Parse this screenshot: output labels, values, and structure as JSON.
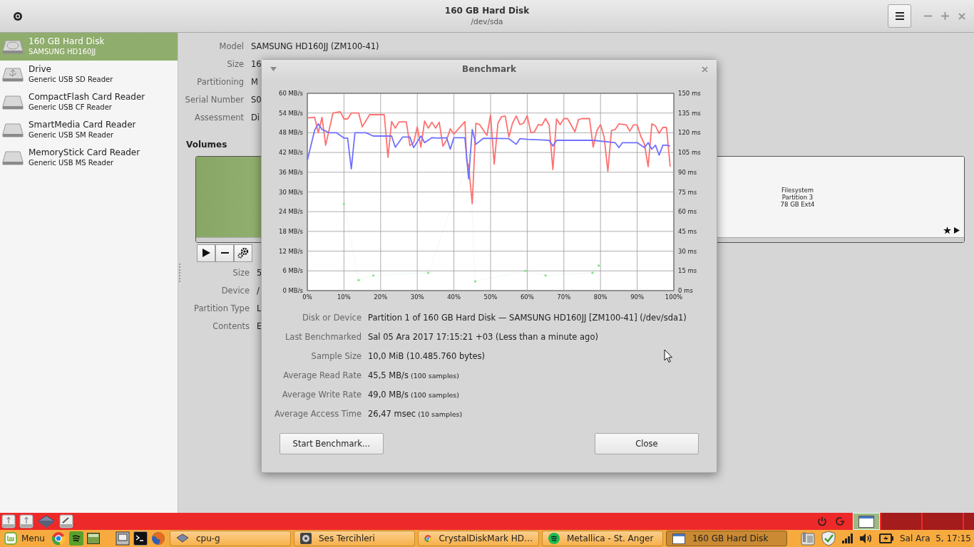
{
  "window": {
    "title": "160 GB Hard Disk",
    "subtitle": "/dev/sda"
  },
  "sidebar": {
    "items": [
      {
        "name": "160 GB Hard Disk",
        "detail": "SAMSUNG HD160JJ",
        "kind": "hdd",
        "selected": true
      },
      {
        "name": "Drive",
        "detail": "Generic USB SD Reader",
        "kind": "usb",
        "selected": false
      },
      {
        "name": "CompactFlash Card Reader",
        "detail": "Generic USB CF Reader",
        "kind": "card",
        "selected": false
      },
      {
        "name": "SmartMedia Card Reader",
        "detail": "Generic USB SM Reader",
        "kind": "card",
        "selected": false
      },
      {
        "name": "MemoryStick Card Reader",
        "detail": "Generic USB MS Reader",
        "kind": "card",
        "selected": false
      }
    ]
  },
  "drive_details": [
    {
      "label": "Model",
      "value": "SAMSUNG HD160JJ (ZM100-41)"
    },
    {
      "label": "Size",
      "value": "16"
    },
    {
      "label": "Partitioning",
      "value": "M"
    },
    {
      "label": "Serial Number",
      "value": "S0"
    },
    {
      "label": "Assessment",
      "value": "Di"
    }
  ],
  "volumes": {
    "heading": "Volumes",
    "partition_lines": [
      "Filesystem",
      "Partition 3",
      "78 GB Ext4"
    ]
  },
  "volume_details": [
    {
      "label": "Size",
      "value": "5"
    },
    {
      "label": "Device",
      "value": "/"
    },
    {
      "label": "Partition Type",
      "value": "L"
    },
    {
      "label": "Contents",
      "value": "E"
    }
  ],
  "dialog": {
    "title": "Benchmark",
    "chart_data": {
      "type": "line",
      "grid": true,
      "xlim": [
        0,
        100
      ],
      "ylim": [
        0,
        60
      ],
      "y2lim": [
        0,
        150
      ],
      "xticks": [
        {
          "value": 0,
          "label": "0%"
        },
        {
          "value": 10,
          "label": "10%"
        },
        {
          "value": 20,
          "label": "20%"
        },
        {
          "value": 30,
          "label": "30%"
        },
        {
          "value": 40,
          "label": "40%"
        },
        {
          "value": 50,
          "label": "50%"
        },
        {
          "value": 60,
          "label": "60%"
        },
        {
          "value": 70,
          "label": "70%"
        },
        {
          "value": 80,
          "label": "80%"
        },
        {
          "value": 90,
          "label": "90%"
        },
        {
          "value": 100,
          "label": "100%"
        }
      ],
      "yticks": [
        {
          "value": 0,
          "label": "0 MB/s"
        },
        {
          "value": 6,
          "label": "6 MB/s"
        },
        {
          "value": 12,
          "label": "12 MB/s"
        },
        {
          "value": 18,
          "label": "18 MB/s"
        },
        {
          "value": 24,
          "label": "24 MB/s"
        },
        {
          "value": 30,
          "label": "30 MB/s"
        },
        {
          "value": 36,
          "label": "36 MB/s"
        },
        {
          "value": 42,
          "label": "42 MB/s"
        },
        {
          "value": 48,
          "label": "48 MB/s"
        },
        {
          "value": 54,
          "label": "54 MB/s"
        },
        {
          "value": 60,
          "label": "60 MB/s"
        }
      ],
      "y2ticks": [
        {
          "value": 0,
          "label": "0 ms"
        },
        {
          "value": 15,
          "label": "15 ms"
        },
        {
          "value": 30,
          "label": "30 ms"
        },
        {
          "value": 45,
          "label": "45 ms"
        },
        {
          "value": 60,
          "label": "60 ms"
        },
        {
          "value": 75,
          "label": "75 ms"
        },
        {
          "value": 90,
          "label": "90 ms"
        },
        {
          "value": 105,
          "label": "105 ms"
        },
        {
          "value": 120,
          "label": "120 ms"
        },
        {
          "value": 135,
          "label": "135 ms"
        },
        {
          "value": 150,
          "label": "150 ms"
        }
      ],
      "series": [
        {
          "color": "#ff7070",
          "x": [
            0,
            2,
            3,
            4,
            5,
            7,
            9,
            10,
            11,
            12,
            14,
            15,
            17,
            21,
            22,
            23,
            24,
            25,
            27,
            28,
            29,
            30,
            31,
            32,
            33,
            34,
            35,
            36,
            37,
            38,
            39,
            40,
            43,
            43.5,
            44,
            45,
            46,
            47,
            49,
            50,
            51,
            52,
            53,
            54,
            55,
            56,
            57,
            58,
            59,
            60,
            61,
            62,
            63,
            64,
            65,
            66,
            67,
            68,
            69,
            70,
            71,
            72,
            73,
            74,
            75,
            77,
            78,
            79,
            80,
            81,
            82,
            83,
            84,
            85,
            87,
            88,
            89,
            90,
            91,
            92,
            93,
            94,
            95,
            96,
            97,
            98,
            99
          ],
          "values": [
            52.5,
            52.7,
            48,
            52.7,
            44.2,
            54,
            54.4,
            52.2,
            52.2,
            54,
            54,
            49.8,
            53.5,
            53.5,
            40.5,
            51.4,
            49.4,
            51.3,
            51.3,
            44.1,
            45,
            49.8,
            43.6,
            51.6,
            49.4,
            51.2,
            49.4,
            51.2,
            43.9,
            45.8,
            49.2,
            47.6,
            51.4,
            39.4,
            38,
            26.4,
            50.9,
            50.5,
            47.2,
            53.4,
            38.5,
            50.9,
            52.9,
            53.1,
            46.7,
            50.9,
            53.1,
            50.5,
            50.9,
            53.2,
            48,
            48.3,
            50.5,
            50.3,
            52.3,
            50.3,
            36.8,
            52.2,
            50.5,
            52.3,
            52.3,
            50.3,
            48.3,
            52,
            52.3,
            52.3,
            43.6,
            48.7,
            50.5,
            46.7,
            36.3,
            48.7,
            49,
            50.7,
            50.4,
            48.5,
            50.4,
            50.4,
            46.9,
            44.5,
            37.7,
            50.7,
            50.1,
            47.8,
            49.6,
            49.6,
            37.7
          ]
        },
        {
          "color": "#7070ff",
          "x": [
            0,
            2,
            3,
            4,
            6,
            8,
            10,
            11,
            12,
            13,
            16,
            18,
            23,
            24,
            26,
            28,
            29,
            31,
            32,
            34,
            36,
            38,
            39,
            40,
            43,
            44,
            45,
            46,
            48,
            55,
            57,
            58,
            60,
            66,
            67,
            68,
            78,
            84,
            85,
            86,
            90,
            92,
            93,
            94,
            95,
            96,
            97,
            98,
            99
          ],
          "values": [
            39.6,
            48.8,
            50.7,
            49,
            48,
            48,
            46.4,
            46.4,
            37,
            48,
            48,
            47,
            47,
            43.6,
            46.7,
            46.7,
            43.5,
            47,
            45,
            46.5,
            46.4,
            46.5,
            43,
            46.5,
            46.5,
            34,
            49,
            44.5,
            46.3,
            46.2,
            44.5,
            46.2,
            46,
            45.7,
            44,
            45.7,
            45.7,
            45,
            43.5,
            45,
            45,
            43.5,
            45,
            43,
            44.2,
            41.2,
            44.2,
            44.2,
            44
          ]
        },
        {
          "axis": "y2",
          "color": "#7ee07e",
          "x": [
            10,
            14,
            18,
            33,
            44.3,
            45.8,
            59.5,
            65,
            77.8,
            79.5
          ],
          "values": [
            66,
            8,
            11.5,
            13.5,
            103,
            7,
            15,
            11.5,
            13.5,
            19
          ]
        }
      ]
    },
    "rows": [
      {
        "label": "Disk or Device",
        "value": "Partition 1 of 160 GB Hard Disk — SAMSUNG HD160JJ [ZM100-41] (/dev/sda1)"
      },
      {
        "label": "Last Benchmarked",
        "value": "Sal 05 Ara 2017 17:15:21 +03 (Less than a minute ago)"
      },
      {
        "label": "Sample Size",
        "value": "10,0 MiB (10.485.760 bytes)"
      },
      {
        "label": "Average Read Rate",
        "value": "45,5 MB/s",
        "note": "(100 samples)"
      },
      {
        "label": "Average Write Rate",
        "value": "49,0 MB/s",
        "note": "(100 samples)"
      },
      {
        "label": "Average Access Time",
        "value": "26,47 msec",
        "note": "(10 samples)"
      }
    ],
    "buttons": [
      "Start Benchmark…",
      "Close"
    ]
  },
  "panel": {
    "workspaces": [
      {
        "selected": true
      },
      {
        "selected": false
      },
      {
        "selected": false
      },
      {
        "selected": false
      }
    ]
  },
  "taskbar": {
    "menu_label": "Menu",
    "windows": [
      {
        "title": "cpu-g",
        "kind": "chip",
        "active": false
      },
      {
        "title": "Ses Tercihleri",
        "kind": "speaker",
        "active": false
      },
      {
        "title": "CrystalDiskMark HD…",
        "kind": "browser",
        "active": false
      },
      {
        "title": "Metallica - St. Anger",
        "kind": "music",
        "active": false
      },
      {
        "title": "160 GB Hard Disk",
        "kind": "window",
        "active": true
      }
    ],
    "clock": "Sal Ara  5, 17:15"
  }
}
